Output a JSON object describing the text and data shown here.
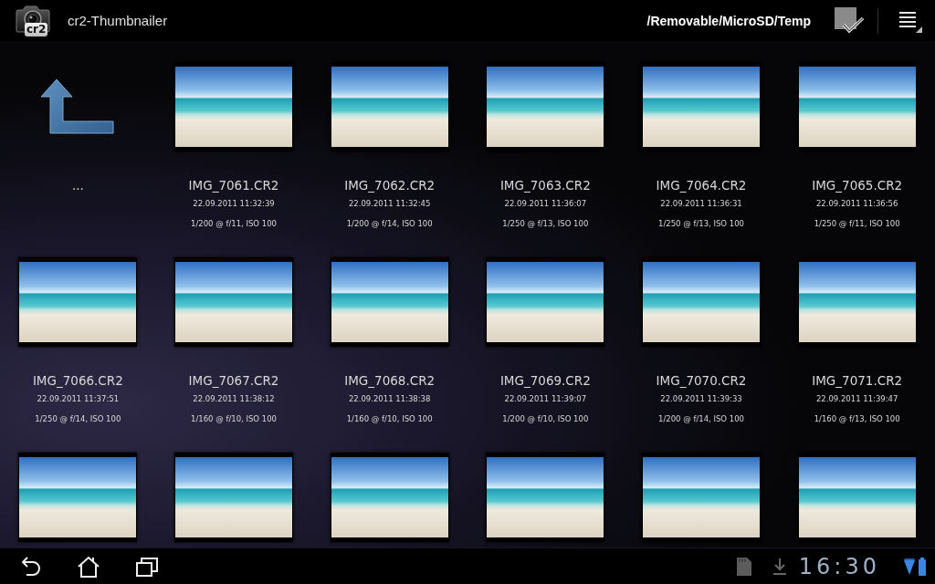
{
  "action_bar": {
    "app_icon_label": "cr2",
    "title": "cr2-Thumbnailer",
    "path": "/Removable/MicroSD/Temp"
  },
  "grid": {
    "items": [
      {
        "kind": "parent",
        "label": "..."
      },
      {
        "kind": "photo",
        "name": "IMG_7061.CR2",
        "date": "22.09.2011 11:32:39",
        "exposure": "1/200 @ f/11, ISO 100"
      },
      {
        "kind": "photo",
        "name": "IMG_7062.CR2",
        "date": "22.09.2011 11:32:45",
        "exposure": "1/200 @ f/14, ISO 100"
      },
      {
        "kind": "photo",
        "name": "IMG_7063.CR2",
        "date": "22.09.2011 11:36:07",
        "exposure": "1/250 @ f/13, ISO 100"
      },
      {
        "kind": "photo",
        "name": "IMG_7064.CR2",
        "date": "22.09.2011 11:36:31",
        "exposure": "1/250 @ f/13, ISO 100"
      },
      {
        "kind": "photo",
        "name": "IMG_7065.CR2",
        "date": "22.09.2011 11:36:56",
        "exposure": "1/250 @ f/11, ISO 100"
      },
      {
        "kind": "photo",
        "name": "IMG_7066.CR2",
        "date": "22.09.2011 11:37:51",
        "exposure": "1/250 @ f/14, ISO 100"
      },
      {
        "kind": "photo",
        "name": "IMG_7067.CR2",
        "date": "22.09.2011 11:38:12",
        "exposure": "1/160 @ f/10, ISO 100"
      },
      {
        "kind": "photo",
        "name": "IMG_7068.CR2",
        "date": "22.09.2011 11:38:38",
        "exposure": "1/160 @ f/10, ISO 100"
      },
      {
        "kind": "photo",
        "name": "IMG_7069.CR2",
        "date": "22.09.2011 11:39:07",
        "exposure": "1/200 @ f/10, ISO 100"
      },
      {
        "kind": "photo",
        "name": "IMG_7070.CR2",
        "date": "22.09.2011 11:39:33",
        "exposure": "1/200 @ f/14, ISO 100"
      },
      {
        "kind": "photo",
        "name": "IMG_7071.CR2",
        "date": "22.09.2011 11:39:47",
        "exposure": "1/160 @ f/13, ISO 100"
      },
      {
        "kind": "photo"
      },
      {
        "kind": "photo"
      },
      {
        "kind": "photo"
      },
      {
        "kind": "photo"
      },
      {
        "kind": "photo"
      },
      {
        "kind": "photo"
      }
    ]
  },
  "system_bar": {
    "time": "16:30"
  }
}
